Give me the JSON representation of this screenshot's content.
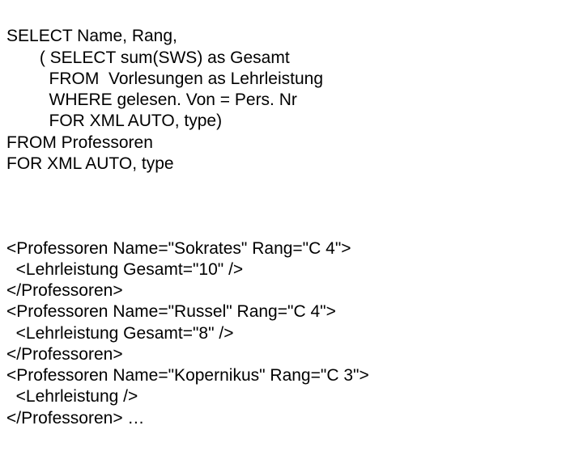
{
  "sql": {
    "l1": "SELECT Name, Rang,",
    "l2": "       ( SELECT sum(SWS) as Gesamt",
    "l3": "         FROM  Vorlesungen as Lehrleistung",
    "l4": "         WHERE gelesen. Von = Pers. Nr",
    "l5": "         FOR XML AUTO, type)",
    "l6": "FROM Professoren",
    "l7": "FOR XML AUTO, type"
  },
  "xml": {
    "l1": "<Professoren Name=\"Sokrates\" Rang=\"C 4\">",
    "l2": "  <Lehrleistung Gesamt=\"10\" />",
    "l3": "</Professoren>",
    "l4": "<Professoren Name=\"Russel\" Rang=\"C 4\">",
    "l5": "  <Lehrleistung Gesamt=\"8\" />",
    "l6": "</Professoren>",
    "l7": "<Professoren Name=\"Kopernikus\" Rang=\"C 3\">",
    "l8": "  <Lehrleistung />",
    "l9": "</Professoren> …"
  }
}
